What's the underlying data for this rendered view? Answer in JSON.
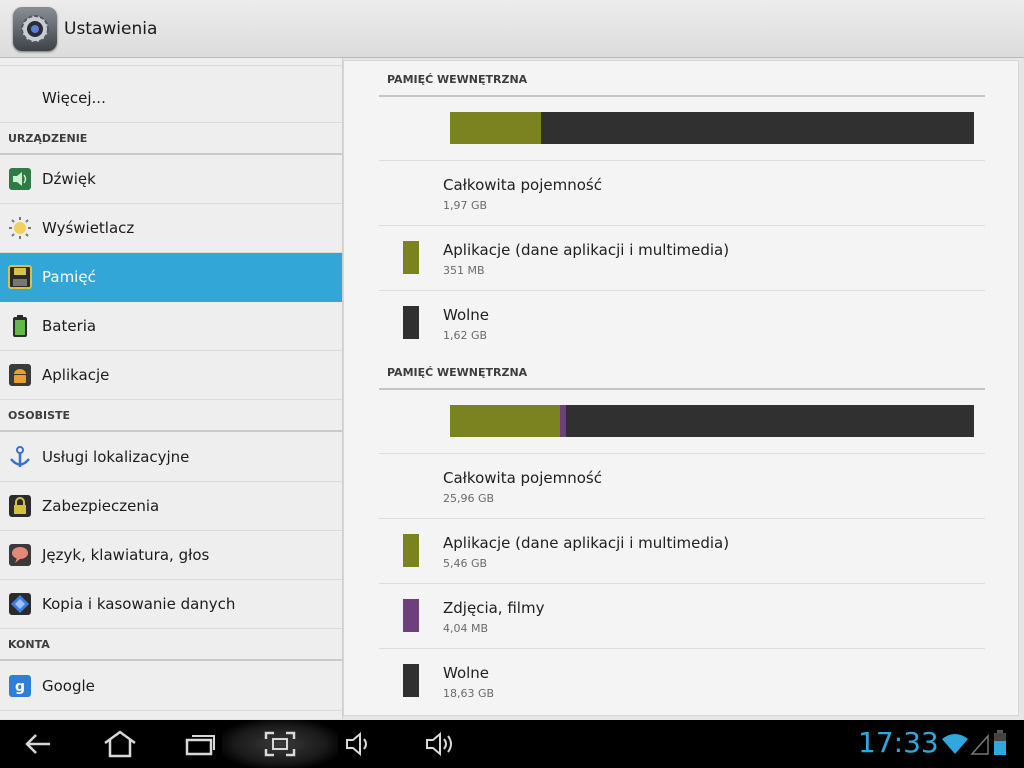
{
  "app": {
    "title": "Ustawienia",
    "icon": "settings-gear-icon"
  },
  "sidebar": {
    "partial_top_item_icon": "data-usage-icon",
    "more": {
      "label": "Więcej..."
    },
    "sections": [
      {
        "header": "URZĄDZENIE"
      },
      {
        "header": "OSOBISTE"
      },
      {
        "header": "KONTA"
      }
    ],
    "items": [
      {
        "label": "Dźwięk",
        "icon": "speaker-icon"
      },
      {
        "label": "Wyświetlacz",
        "icon": "brightness-icon"
      },
      {
        "label": "Pamięć",
        "icon": "storage-icon",
        "selected": true
      },
      {
        "label": "Bateria",
        "icon": "battery-icon"
      },
      {
        "label": "Aplikacje",
        "icon": "android-icon"
      },
      {
        "label": "Usługi lokalizacyjne",
        "icon": "location-icon"
      },
      {
        "label": "Zabezpieczenia",
        "icon": "lock-icon"
      },
      {
        "label": "Język, klawiatura, głos",
        "icon": "speech-bubble-icon"
      },
      {
        "label": "Kopia i kasowanie danych",
        "icon": "backup-icon"
      },
      {
        "label": "Google",
        "icon": "google-icon"
      }
    ]
  },
  "storage": [
    {
      "header": "PAMIĘĆ WEWNĘTRZNA",
      "bar": {
        "apps_fraction": 0.174,
        "media_fraction": 0.0
      },
      "rows": [
        {
          "title": "Całkowita pojemność",
          "value": "1,97 GB",
          "color": ""
        },
        {
          "title": "Aplikacje (dane aplikacji i multimedia)",
          "value": "351 MB",
          "color": "#7a8320"
        },
        {
          "title": "Wolne",
          "value": "1,62 GB",
          "color": "#303030"
        }
      ]
    },
    {
      "header": "PAMIĘĆ WEWNĘTRZNA",
      "bar": {
        "apps_fraction": 0.21,
        "media_fraction": 0.012
      },
      "rows": [
        {
          "title": "Całkowita pojemność",
          "value": "25,96 GB",
          "color": ""
        },
        {
          "title": "Aplikacje (dane aplikacji i multimedia)",
          "value": "5,46 GB",
          "color": "#7a8320"
        },
        {
          "title": "Zdjęcia, filmy",
          "value": "4,04 MB",
          "color": "#6e3f7d"
        },
        {
          "title": "Wolne",
          "value": "18,63 GB",
          "color": "#303030"
        }
      ]
    }
  ],
  "system_bar": {
    "time": "17:33",
    "buttons": [
      "back-icon",
      "home-icon",
      "recent-apps-icon",
      "screenshot-icon",
      "volume-down-icon",
      "volume-up-icon"
    ],
    "status_icons": [
      "wifi-icon",
      "signal-icon",
      "battery-status-icon"
    ],
    "accent": "#2fa8e0"
  },
  "colors": {
    "selected": "#33a6d8",
    "apps": "#7a8320",
    "media": "#6e3f7d",
    "free": "#303030"
  }
}
